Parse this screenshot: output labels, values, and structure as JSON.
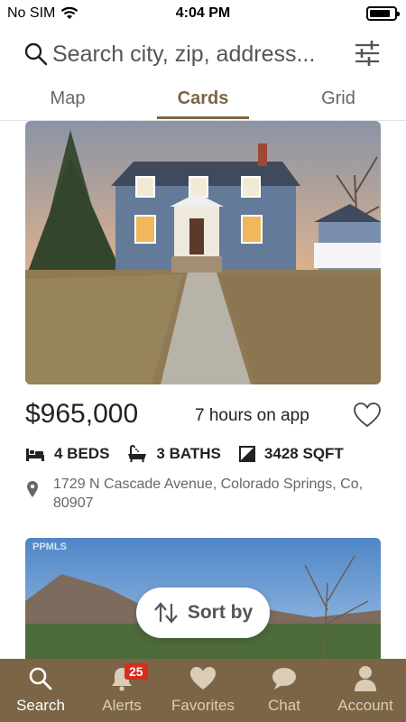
{
  "status_bar": {
    "carrier": "No SIM",
    "time": "4:04 PM"
  },
  "search": {
    "placeholder": "Search city, zip, address..."
  },
  "tabs": [
    {
      "label": "Map"
    },
    {
      "label": "Cards",
      "active": true
    },
    {
      "label": "Grid"
    }
  ],
  "listings": [
    {
      "price": "$965,000",
      "posted": "7 hours on app",
      "beds": "4 BEDS",
      "baths": "3 BATHS",
      "sqft": "3428 SQFT",
      "address": "1729 N Cascade Avenue, Colorado Springs, Co, 80907",
      "favorited": false
    },
    {
      "watermark": "PPMLS"
    }
  ],
  "sort": {
    "label": "Sort by"
  },
  "bottom_nav": [
    {
      "label": "Search",
      "icon": "search-icon",
      "active": true
    },
    {
      "label": "Alerts",
      "icon": "bell-icon",
      "badge": "25"
    },
    {
      "label": "Favorites",
      "icon": "heart-icon"
    },
    {
      "label": "Chat",
      "icon": "chat-icon"
    },
    {
      "label": "Account",
      "icon": "person-icon"
    }
  ],
  "colors": {
    "brand": "#7c6546",
    "badge": "#d72c1f"
  }
}
